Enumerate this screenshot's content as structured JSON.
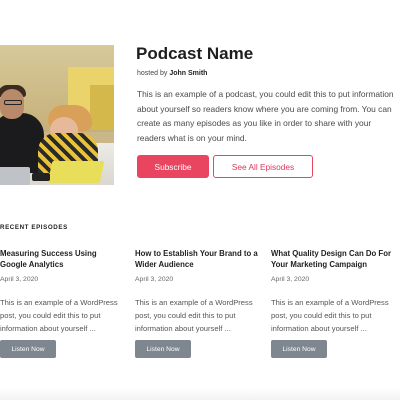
{
  "podcast": {
    "title": "Podcast Name",
    "hosted_prefix": "hosted by",
    "host_name": "John Smith",
    "description": "This is an example of a podcast, you could edit this to put information about yourself so readers know where you are coming from. You can create as many episodes as you like in order to share with your readers what is on your mind.",
    "subscribe_label": "Subscribe",
    "all_episodes_label": "See All Episodes"
  },
  "recent": {
    "section_label": "RECENT EPISODES",
    "episodes": [
      {
        "title": "Measuring Success Using Google Analytics",
        "date": "April 3, 2020",
        "excerpt": "This is an example of a WordPress post, you could edit this to put information about yourself ...",
        "button": "Listen Now"
      },
      {
        "title": "How to Establish Your Brand to a Wider Audience",
        "date": "April 3, 2020",
        "excerpt": "This is an example of a WordPress post, you could edit this to put information about yourself ...",
        "button": "Listen Now"
      },
      {
        "title": "What Quality Design Can Do For Your Marketing Campaign",
        "date": "April 3, 2020",
        "excerpt": "This is an example of a WordPress post, you could edit this to put information about yourself ...",
        "button": "Listen Now"
      }
    ]
  },
  "colors": {
    "accent": "#e94560",
    "button_grey": "#7e868f"
  }
}
